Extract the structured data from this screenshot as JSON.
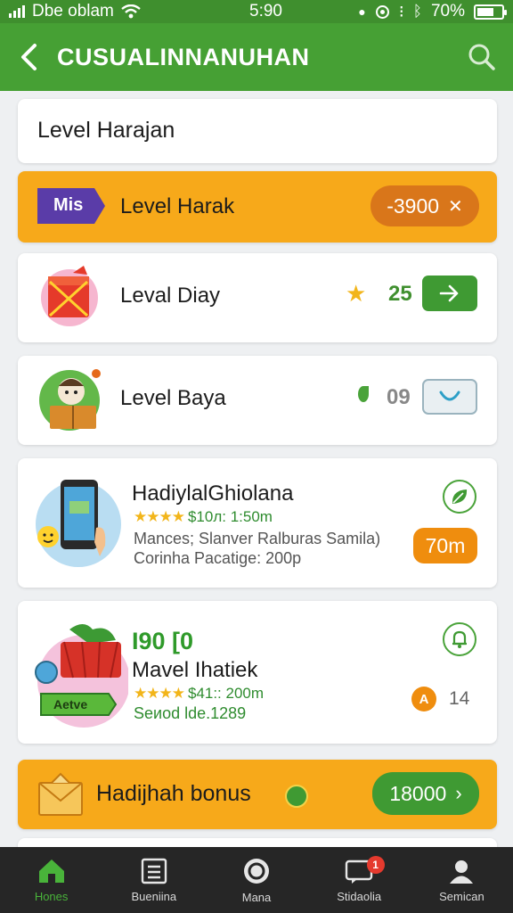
{
  "status_bar": {
    "carrier": "Dbe oblam",
    "time": "5:90",
    "battery": "70%",
    "battery_level": 0.7
  },
  "app_bar": {
    "title": "CUSUALINNANUHAN"
  },
  "header_card": {
    "title": "Level Harajan"
  },
  "level_harak": {
    "tag": "Mis",
    "title": "Level Harak",
    "value": "-3900"
  },
  "level_diay": {
    "title": "Leval Diay",
    "score": "25"
  },
  "level_baya": {
    "title": "Level Baya",
    "score": "09"
  },
  "product_1": {
    "title": "HadiylalGhiolana",
    "stars": "★★★★",
    "meta": "$10л: 1:50m",
    "line1": "Mances; Slanver Ralburas Samila)",
    "line2": "Corinha Pacatige: 200p",
    "price": "70m"
  },
  "product_2": {
    "headline": "I90 [0",
    "title": "Mavel Ihatiek",
    "stars": "★★★★",
    "meta": "$41:: 200m",
    "line1": "Seиod lde.1289",
    "badge": "A",
    "count": "14",
    "sign_text": "Aetve"
  },
  "bonus": {
    "title": "Hadijhah bonus",
    "value": "18000"
  },
  "bottom_nav": [
    {
      "label": "Hones",
      "icon": "home-icon",
      "active": true
    },
    {
      "label": "Bueniina",
      "icon": "list-icon",
      "active": false
    },
    {
      "label": "Mana",
      "icon": "profile-circle-icon",
      "active": false
    },
    {
      "label": "Stidaolia",
      "icon": "chat-icon",
      "active": false,
      "badge": "1"
    },
    {
      "label": "Semican",
      "icon": "user-icon",
      "active": false
    }
  ],
  "colors": {
    "brand_green": "#46a034",
    "accent_orange": "#f7a91a",
    "nav_bg": "#262626"
  }
}
